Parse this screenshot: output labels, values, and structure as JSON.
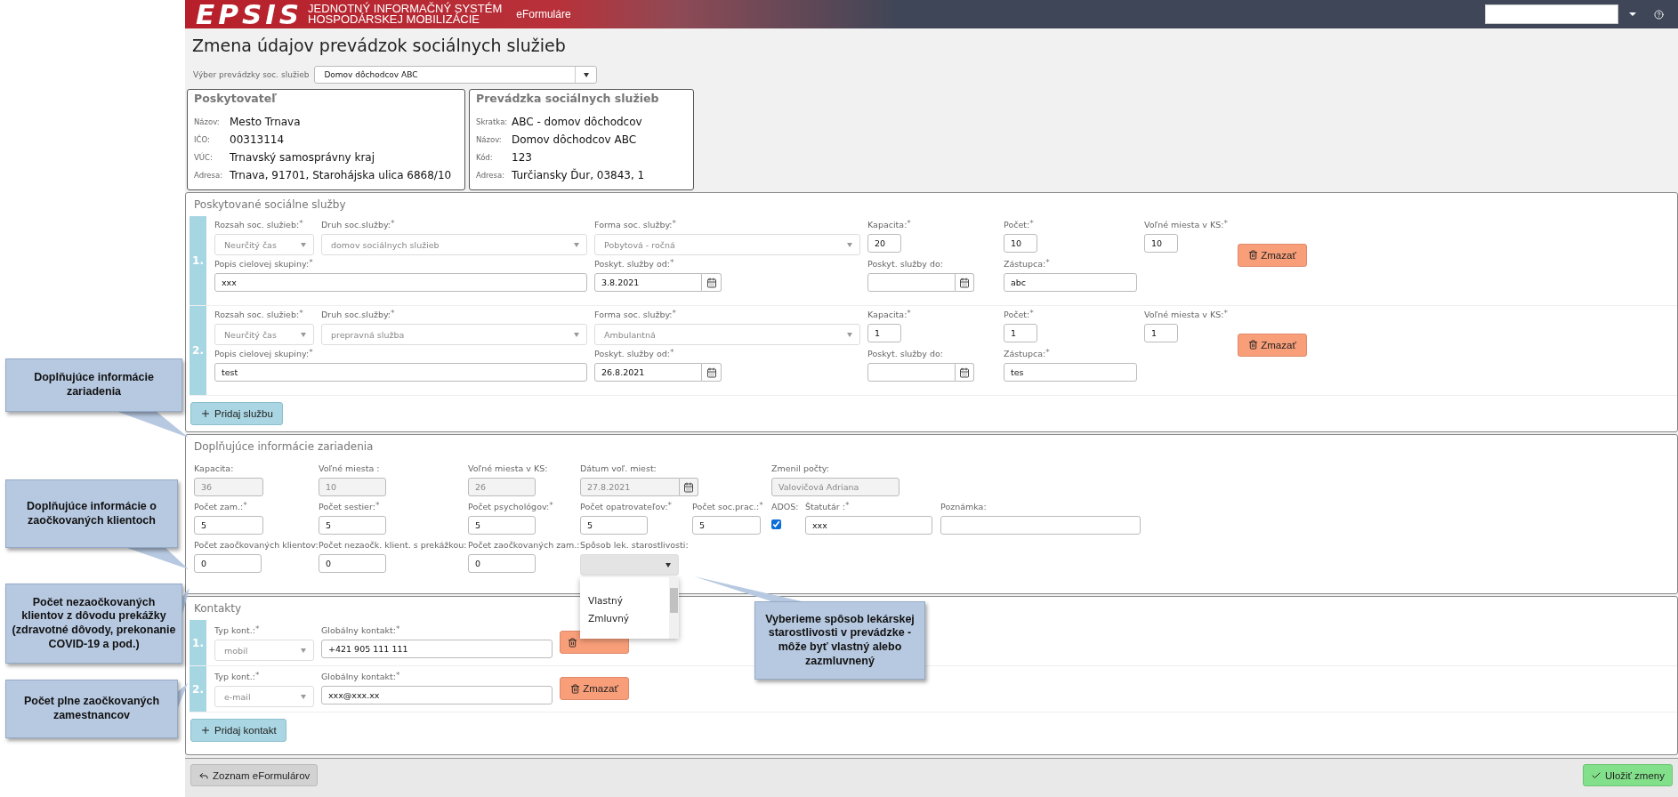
{
  "header": {
    "logo": "EPSIS",
    "system_line1": "JEDNOTNÝ INFORMAČNÝ SYSTÉM",
    "system_line2": "HOSPODÁRSKEJ MOBILIZÁCIE",
    "nav_link": "eFormuláre"
  },
  "title": "Zmena údajov prevádzok sociálnych služieb",
  "facility_select": {
    "label": "Výber prevádzky soc. služieb",
    "value": "Domov dôchodcov ABC"
  },
  "info_cards": [
    {
      "title": "Poskytovateľ",
      "rows": [
        {
          "label": "Názov:",
          "value": "Mesto Trnava"
        },
        {
          "label": "IČO:",
          "value": "00313114"
        },
        {
          "label": "VÚC:",
          "value": "Trnavský samosprávny kraj"
        },
        {
          "label": "Adresa:",
          "value": "Trnava, 91701, Starohájska ulica 6868/10"
        }
      ]
    },
    {
      "title": "Prevádzka sociálnych služieb",
      "rows": [
        {
          "label": "Skratka:",
          "value": "ABC - domov dôchodcov"
        },
        {
          "label": "Názov:",
          "value": "Domov dôchodcov ABC"
        },
        {
          "label": "Kód:",
          "value": "123"
        },
        {
          "label": "Adresa:",
          "value": "Turčiansky Ďur, 03843, 1"
        }
      ]
    }
  ],
  "services": {
    "title": "Poskytované sociálne služby",
    "add_label": "Pridaj službu",
    "items": [
      {
        "number": "1.",
        "delete_label": "Zmazať",
        "fields": [
          {
            "kind": "select",
            "label": "Rozsah soc. služieb:$^{*}$",
            "value": "Neurčitý čas",
            "disabled": true
          },
          {
            "kind": "select",
            "label": "Druh soc.služby:$^{*}$",
            "value": "domov sociálnych služieb",
            "disabled": true
          },
          {
            "kind": "select",
            "label": "Forma soc. služby:$^{*}$",
            "value": "Pobytová - ročná",
            "disabled": true
          },
          {
            "kind": "text",
            "label": "Kapacita:$^{*}$",
            "value": "20",
            "disabled": false
          },
          {
            "kind": "text",
            "label": "Počet:$^{*}$",
            "value": "10",
            "disabled": false
          },
          {
            "kind": "text",
            "label": "Voľné miesta v KS:$^{*}$",
            "value": "10",
            "disabled": false
          },
          {
            "kind": "text",
            "label": "Popis cielovej skupiny:$^{*}$",
            "value": "xxx",
            "disabled": false
          },
          {
            "kind": "date",
            "label": "Poskyt. služby od:$^{*}$",
            "value": "3.8.2021",
            "disabled": false
          },
          {
            "kind": "date",
            "label": "Poskyt. služby do:"
          },
          {
            "kind": "text",
            "label": "Zástupca:$^{*}$",
            "value": "abc",
            "disabled": false
          }
        ]
      },
      {
        "number": "2.",
        "delete_label": "Zmazať",
        "fields": [
          {
            "kind": "select",
            "label": "Rozsah soc. služieb:$^{*}$",
            "value": "Neurčitý čas",
            "disabled": true
          },
          {
            "kind": "select",
            "label": "Druh soc.služby:$^{*}$",
            "value": "prepravná služba",
            "disabled": true
          },
          {
            "kind": "select",
            "label": "Forma soc. služby:$^{*}$",
            "value": "Ambulantná",
            "disabled": true
          },
          {
            "kind": "text",
            "label": "Kapacita:$^{*}$",
            "value": "1",
            "disabled": false
          },
          {
            "kind": "text",
            "label": "Počet:$^{*}$",
            "value": "1",
            "disabled": false
          },
          {
            "kind": "text",
            "label": "Voľné miesta v KS:$^{*}$",
            "value": "1",
            "disabled": false
          },
          {
            "kind": "text",
            "label": "Popis cielovej skupiny:$^{*}$",
            "value": "test",
            "disabled": false
          },
          {
            "kind": "date",
            "label": "Poskyt. služby od:$^{*}$",
            "value": "26.8.2021",
            "disabled": false
          },
          {
            "kind": "date",
            "label": "Poskyt. služby do:"
          },
          {
            "kind": "text",
            "label": "Zástupca:$^{*}$",
            "value": "tes",
            "disabled": false
          }
        ]
      }
    ]
  },
  "extra_info": {
    "title": "Doplňujúce informácie zariadenia",
    "rows": [
      [
        {
          "kind": "text",
          "label": "Kapacita:",
          "value": "36",
          "disabled": true
        },
        {
          "kind": "text",
          "label": "Voľné miesta :",
          "value": "10",
          "disabled": true
        },
        {
          "kind": "text",
          "label": "Voľné miesta v KS:",
          "value": "26",
          "disabled": true
        },
        {
          "kind": "date",
          "label": "Dátum voľ. miest:",
          "value": "27.8.2021",
          "disabled": true
        },
        "",
        {
          "kind": "text",
          "label": "Zmenil počty:",
          "value": "Valovičová Adriana",
          "disabled": true
        }
      ],
      [
        {
          "kind": "text",
          "label": "Počet zam.:$^{*}$",
          "value": "5",
          "disabled": false
        },
        {
          "kind": "text",
          "label": "Počet sestier:$^{*}$",
          "value": "5",
          "disabled": false
        },
        {
          "kind": "text",
          "label": "Počet psychológov:$^{*}$",
          "value": "5",
          "disabled": false
        },
        {
          "kind": "text",
          "label": "Počet opatrovateľov:$^{*}$",
          "value": "5",
          "disabled": false
        },
        {
          "kind": "text",
          "label": "Počet soc.prac.:$^{*}$",
          "value": "5",
          "disabled": false
        },
        {
          "kind": "checkbox",
          "label": "ADOS:",
          "checked": true
        },
        {
          "kind": "text",
          "label": "Štatutár :$^{*}$",
          "value": "xxx",
          "disabled": false
        },
        {
          "kind": "text",
          "label": "Poznámka:"
        }
      ],
      [
        {
          "kind": "text",
          "label": "Počet zaočkovaných klientov:",
          "value": "0",
          "disabled": false
        },
        {
          "kind": "text",
          "label": "Počet nezaočk. klient. s prekážkou:",
          "value": "0",
          "disabled": false
        },
        {
          "kind": "text",
          "label": "Počet zaočkovaných zam.:",
          "value": "0",
          "disabled": false
        },
        {
          "kind": "select",
          "label": "Spôsob lek. starostlivosti:",
          "open": true,
          "disabled": false,
          "options": [
            {
              "label": "Vlastný",
              "selected": false
            },
            {
              "label": "Zmluvný",
              "selected": false
            }
          ]
        }
      ]
    ]
  },
  "contacts": {
    "title": "Kontakty",
    "add_label": "Pridaj kontakt",
    "items": [
      {
        "number": "1.",
        "fields": [
          {
            "kind": "select",
            "label": "Typ kont.:$^{*}$",
            "value": "mobil",
            "disabled": true
          },
          {
            "kind": "text",
            "label": "Globálny kontakt:$^{*}$",
            "value": "+421 905 111 111",
            "disabled": false
          }
        ]
      },
      {
        "number": "2.",
        "delete_label": "Zmazať",
        "fields": [
          {
            "kind": "select",
            "label": "Typ kont.:$^{*}$",
            "value": "e-mail",
            "disabled": true
          },
          {
            "kind": "text",
            "label": "Globálny kontakt:$^{*}$",
            "value": "xxx@xxx.xx",
            "disabled": false
          }
        ]
      }
    ]
  },
  "footer": {
    "back_label": "Zoznam eFormulárov",
    "save_label": "Uložiť zmeny"
  },
  "callouts": [
    {
      "text": "Doplňujúce informácie zariadenia"
    },
    {
      "text": "Doplňujúce informácie o zaočkovaných klientoch"
    },
    {
      "text": "Počet nezaočkovaných klientov z dôvodu prekážky (zdravotné dôvody, prekonanie COVID-19 a pod.)"
    },
    {
      "text": "Počet plne zaočkovaných zamestnancov"
    },
    {
      "text": "Vyberieme spôsob lekárskej starostlivosti v prevádzke - môže byť vlastný alebo zazmluvnený"
    }
  ]
}
